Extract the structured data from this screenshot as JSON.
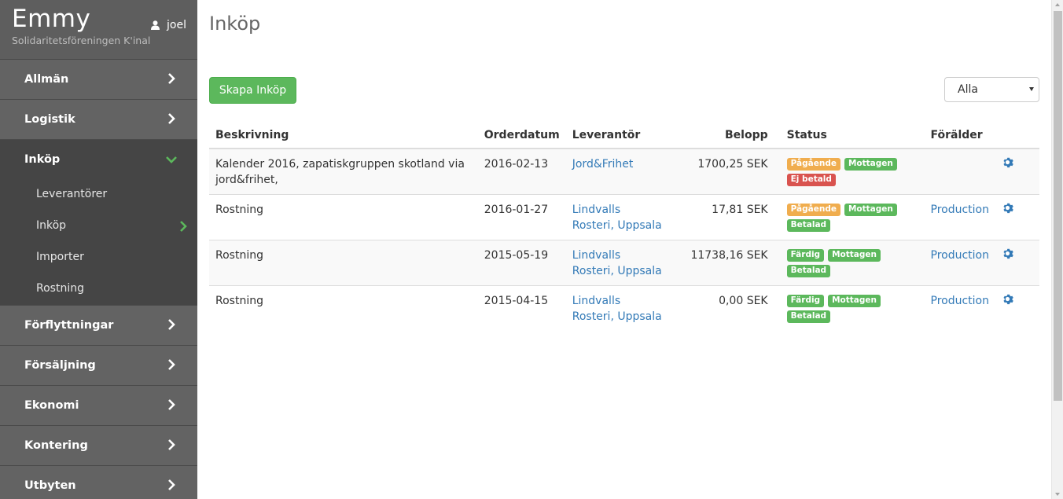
{
  "sidebar": {
    "brand_title": "Emmy",
    "brand_subtitle": "Solidaritetsföreningen K'inal",
    "user_name": "joel",
    "items": [
      {
        "label": "Allmän",
        "icon": "chevron-right-icon"
      },
      {
        "label": "Logistik",
        "icon": "chevron-right-icon"
      },
      {
        "label": "Inköp",
        "icon": "chevron-down-icon",
        "open": true,
        "children": [
          {
            "label": "Leverantörer"
          },
          {
            "label": "Inköp",
            "active": true
          },
          {
            "label": "Importer"
          },
          {
            "label": "Rostning"
          }
        ]
      },
      {
        "label": "Förflyttningar",
        "icon": "chevron-right-icon"
      },
      {
        "label": "Försäljning",
        "icon": "chevron-right-icon"
      },
      {
        "label": "Ekonomi",
        "icon": "chevron-right-icon"
      },
      {
        "label": "Kontering",
        "icon": "chevron-right-icon"
      },
      {
        "label": "Utbyten",
        "icon": "chevron-right-icon"
      }
    ]
  },
  "main": {
    "title": "Inköp",
    "create_button": "Skapa Inköp",
    "filter_value": "Alla",
    "table": {
      "headers": [
        "Beskrivning",
        "Orderdatum",
        "Leverantör",
        "Belopp",
        "Status",
        "Förälder"
      ],
      "rows": [
        {
          "description": "Kalender 2016, zapatiskgruppen skotland via jord&frihet,",
          "date": "2016-02-13",
          "supplier": "Jord&Frihet",
          "amount": "1700,25 SEK",
          "status": [
            {
              "text": "Pågående",
              "kind": "warn"
            },
            {
              "text": "Mottagen",
              "kind": "ok"
            },
            {
              "text": "Ej betald",
              "kind": "danger"
            }
          ],
          "parent": ""
        },
        {
          "description": "Rostning",
          "date": "2016-01-27",
          "supplier": "Lindvalls Rosteri, Uppsala",
          "amount": "17,81 SEK",
          "status": [
            {
              "text": "Pågående",
              "kind": "warn"
            },
            {
              "text": "Mottagen",
              "kind": "ok"
            },
            {
              "text": "Betalad",
              "kind": "ok"
            }
          ],
          "parent": "Production"
        },
        {
          "description": "Rostning",
          "date": "2015-05-19",
          "supplier": "Lindvalls Rosteri, Uppsala",
          "amount": "11738,16 SEK",
          "status": [
            {
              "text": "Färdig",
              "kind": "ok"
            },
            {
              "text": "Mottagen",
              "kind": "ok"
            },
            {
              "text": "Betalad",
              "kind": "ok"
            }
          ],
          "parent": "Production"
        },
        {
          "description": "Rostning",
          "date": "2015-04-15",
          "supplier": "Lindvalls Rosteri, Uppsala",
          "amount": "0,00 SEK",
          "status": [
            {
              "text": "Färdig",
              "kind": "ok"
            },
            {
              "text": "Mottagen",
              "kind": "ok"
            },
            {
              "text": "Betalad",
              "kind": "ok"
            }
          ],
          "parent": "Production"
        }
      ]
    }
  },
  "colors": {
    "sidebar": "#5e5e5e",
    "sidebar_open": "#454545",
    "accent_green": "#5cb85c",
    "link": "#337ab7",
    "warning": "#f0ad4e",
    "danger": "#d9534f"
  }
}
